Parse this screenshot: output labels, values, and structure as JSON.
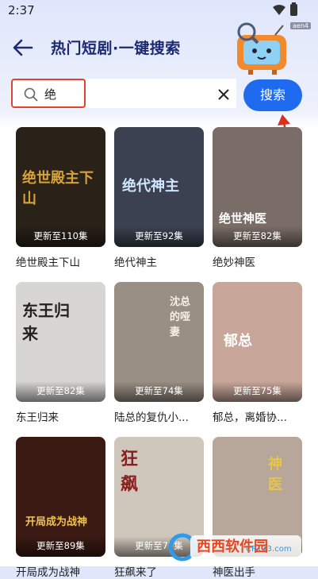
{
  "status_bar": {
    "time": "2:37"
  },
  "header": {
    "title": "热门短剧·一键搜索",
    "tag": "aen4"
  },
  "search": {
    "value": "绝",
    "button_label": "搜索"
  },
  "dramas": [
    {
      "title": "绝世殿主下山",
      "episodes": "更新至110集",
      "art": "绝世殿主下山",
      "bg": "#2a2118",
      "art_color": "#d7a23a"
    },
    {
      "title": "绝代神主",
      "episodes": "更新至92集",
      "art": "绝代神主",
      "bg": "#3b4150",
      "art_color": "#cfe6ff"
    },
    {
      "title": "绝妙神医",
      "episodes": "更新至82集",
      "art": "绝世神医",
      "bg": "#7a6c66",
      "art_color": "#ffffff"
    },
    {
      "title": "东王归来",
      "episodes": "更新至82集",
      "art": "东王归来",
      "bg": "#d8d6d2",
      "art_color": "#222222"
    },
    {
      "title": "陆总的复仇小...",
      "episodes": "更新至74集",
      "art": "沈总的哑妻",
      "bg": "#9a8f85",
      "art_color": "#f5f0e8"
    },
    {
      "title": "郁总，离婚协...",
      "episodes": "更新至75集",
      "art": "郁总",
      "bg": "#c8a79a",
      "art_color": "#ffffff"
    },
    {
      "title": "开局成为战神",
      "episodes": "更新至89集",
      "art": "开局成为战神",
      "bg": "#3a1a12",
      "art_color": "#f2c34a"
    },
    {
      "title": "狂飙来了",
      "episodes": "更新至77集",
      "art": "狂飙",
      "bg": "#cfc7bb",
      "art_color": "#8b1e1e"
    },
    {
      "title": "神医出手",
      "episodes": "",
      "art": "神医",
      "bg": "#b6a79a",
      "art_color": "#e8c44a"
    }
  ],
  "footer": {
    "brand": "西西软件园",
    "url": "CR173.com"
  }
}
